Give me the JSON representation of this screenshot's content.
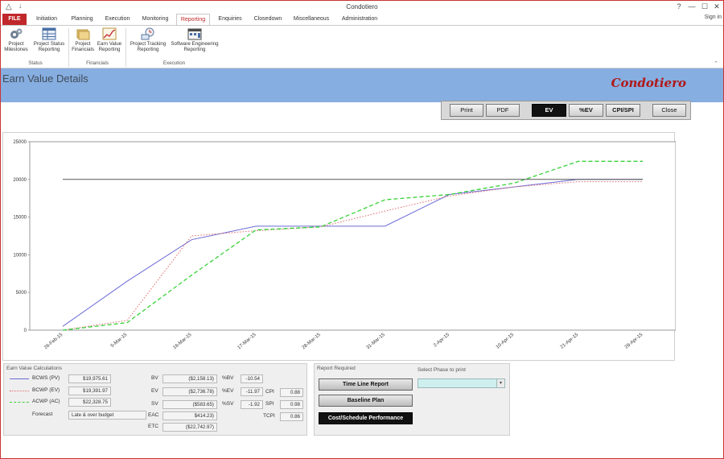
{
  "window": {
    "title": "Condotiero",
    "sign_in": "Sign in",
    "controls": {
      "help": "?",
      "minimize": "—",
      "maximize": "☐",
      "close": "✕"
    }
  },
  "ribbon": {
    "tabs": [
      "FILE",
      "Initiation",
      "Planning",
      "Execution",
      "Monitoring",
      "Reporting",
      "Enquiries",
      "Closedown",
      "Miscellaneous",
      "Administration"
    ],
    "active_tab": "Reporting",
    "buttons": [
      {
        "line1": "Project",
        "line2": "Milestones",
        "icon": "gears-icon"
      },
      {
        "line1": "Project Status",
        "line2": "Reporting",
        "icon": "report-grid-icon"
      },
      {
        "line1": "Project",
        "line2": "Financials",
        "icon": "folders-icon"
      },
      {
        "line1": "Earn Value",
        "line2": "Reporting",
        "icon": "line-chart-icon"
      },
      {
        "line1": "Project Tracking",
        "line2": "Reporting",
        "icon": "tracking-icon"
      },
      {
        "line1": "Software Engineering",
        "line2": "Reporting",
        "icon": "calendar-grid-icon"
      }
    ],
    "groups": [
      "Status",
      "Financials",
      "Execution"
    ]
  },
  "header": {
    "page_title": "Earn Value Details",
    "brand": "Condotiero"
  },
  "toolbar": {
    "print": "Print",
    "pdf": "PDF",
    "ev": "EV",
    "pct_ev": "%EV",
    "cpi_spi": "CPI/SPI",
    "close": "Close"
  },
  "chart_data": {
    "type": "line",
    "x": [
      "26-Feb-15",
      "5-Mar-15",
      "16-Mar-15",
      "17-Mar-15",
      "28-Mar-15",
      "31-Mar-15",
      "2-Apr-15",
      "10-Apr-15",
      "21-Apr-15",
      "28-Apr-15"
    ],
    "ylim": [
      0,
      25000
    ],
    "yticks": [
      0,
      5000,
      10000,
      15000,
      20000,
      25000
    ],
    "grid": false,
    "series": [
      {
        "name": "BCWS (PV)",
        "color": "#6b6bd8",
        "dash": "solid",
        "values": [
          500,
          6500,
          12000,
          13800,
          13800,
          13800,
          18000,
          19000,
          20000,
          20000
        ]
      },
      {
        "name": "BCWP (EV)",
        "color": "#e06a6a",
        "dash": "dot",
        "values": [
          0,
          1300,
          12500,
          13200,
          13700,
          15800,
          17800,
          19000,
          19700,
          19700
        ]
      },
      {
        "name": "ACWP (AC)",
        "color": "#3ad23a",
        "dash": "dash",
        "values": [
          0,
          1000,
          7300,
          13300,
          13700,
          17300,
          18000,
          19500,
          22400,
          22400
        ]
      },
      {
        "name": "",
        "color": "#555555",
        "dash": "solid",
        "values": [
          20000,
          20000,
          20000,
          20000,
          20000,
          20000,
          20000,
          20000,
          20000,
          20000
        ]
      }
    ]
  },
  "ev_calc": {
    "title": "Earn Value Calculations",
    "legend": [
      {
        "label": "BCWS (PV)",
        "value": "$19,975.61"
      },
      {
        "label": "BCWP (EV)",
        "value": "$19,391.97"
      },
      {
        "label": "ACWP (AC)",
        "value": "$22,328.75"
      }
    ],
    "forecast_label": "Forecast",
    "forecast_value": "Late & over budget",
    "bv_label": "BV",
    "bv": "($2,158.13)",
    "ev_label": "EV",
    "ev": "($2,736.78)",
    "sv_label": "SV",
    "sv": "($583.65)",
    "eac_label": "EAC",
    "eac": "$414.23)",
    "etc_label": "ETC",
    "etc": "($22,742.97)",
    "pbv_label": "%BV",
    "pbv": "-10.54",
    "pev_label": "%EV",
    "pev": "-11.97",
    "psv_label": "%SV",
    "psv": "-1.92",
    "cpi_label": "CPI",
    "cpi": "0.88",
    "spi_label": "SPI",
    "spi": "0.98",
    "tcpi_label": "TCPI",
    "tcpi": "0.86"
  },
  "report": {
    "title": "Report Required",
    "phase_title": "Select Phase to print",
    "phase_value": "",
    "timeline": "Time Line Report",
    "baseline": "Baseline Plan",
    "costsched": "Cost/Schedule Performance"
  }
}
